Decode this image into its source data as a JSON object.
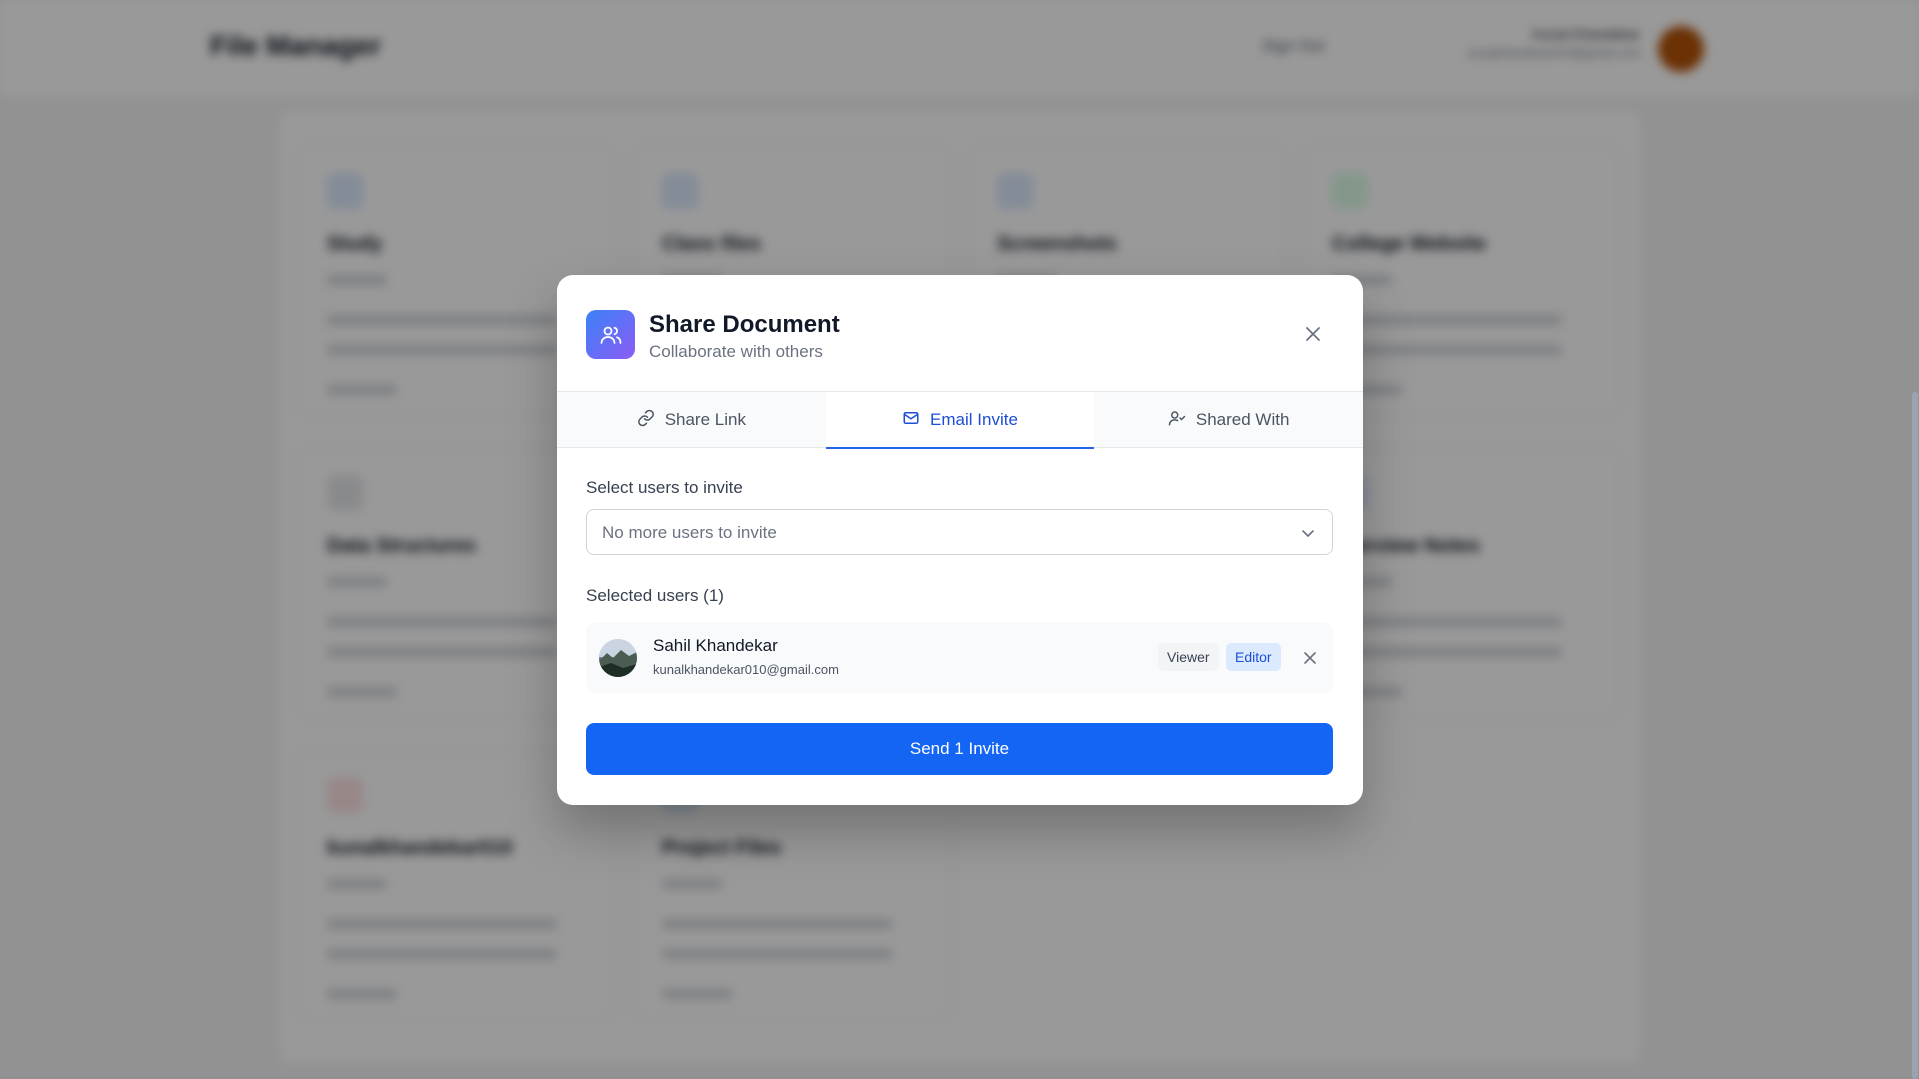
{
  "background": {
    "app_title": "File Manager",
    "signout_label": "Sign Out",
    "user_name": "Kunal Khandekar",
    "user_email": "kunalkhandekar010@gmail.com",
    "cards": [
      {
        "name": "Study"
      },
      {
        "name": "Class files"
      },
      {
        "name": "Screenshots"
      },
      {
        "name": "College Website",
        "icon": "green"
      },
      {
        "name": "Data Structures"
      },
      {
        "name": ""
      },
      {
        "name": ""
      },
      {
        "name": "Interview Notes"
      },
      {
        "name": "kunalkhandekar010",
        "icon": "red"
      },
      {
        "name": "Project Files"
      }
    ]
  },
  "modal": {
    "title": "Share Document",
    "subtitle": "Collaborate with others",
    "tabs": [
      {
        "label": "Share Link",
        "icon": "link-icon"
      },
      {
        "label": "Email Invite",
        "icon": "mail-icon",
        "active": true
      },
      {
        "label": "Shared With",
        "icon": "user-check-icon"
      }
    ],
    "select_label": "Select users to invite",
    "select_value": "No more users to invite",
    "selected_label": "Selected users (1)",
    "selected_users": [
      {
        "name": "Sahil Khandekar",
        "email": "kunalkhandekar010@gmail.com",
        "role": "Editor"
      }
    ],
    "roles": {
      "viewer": "Viewer",
      "editor": "Editor"
    },
    "send_label": "Send 1 Invite"
  },
  "colors": {
    "accent": "#1565f5",
    "active_tab": "#1d4ed8",
    "editor_badge_bg": "#dbeafe",
    "overlay": "rgba(0,0,0,0.40)"
  }
}
